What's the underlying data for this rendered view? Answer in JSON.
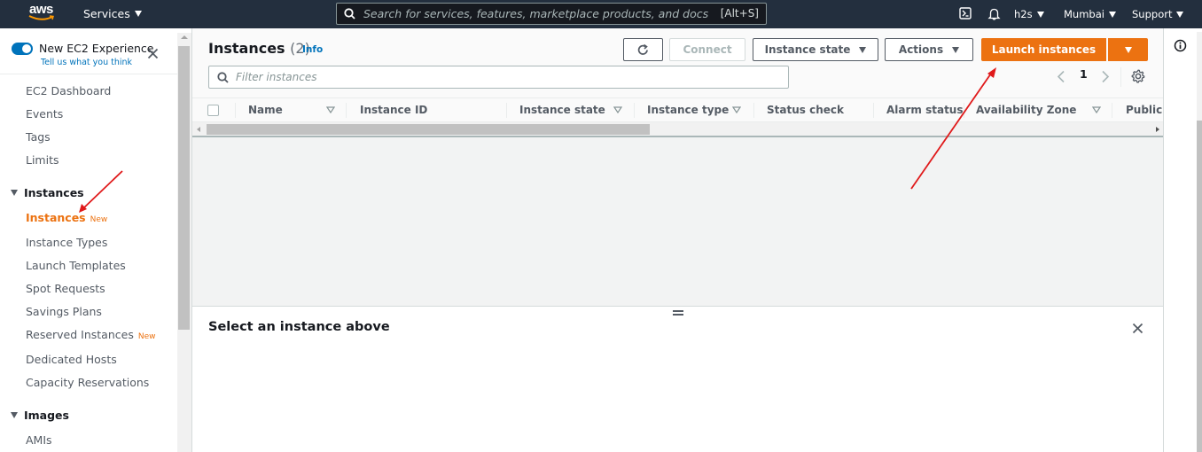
{
  "topnav": {
    "logo": "aws",
    "services_label": "Services",
    "search_placeholder": "Search for services, features, marketplace products, and docs",
    "search_shortcut": "[Alt+S]",
    "account_label": "h2s",
    "region_label": "Mumbai",
    "support_label": "Support",
    "icons": [
      "cloudshell-icon",
      "bell-icon"
    ]
  },
  "sidebar": {
    "new_experience_label": "New EC2 Experience",
    "new_experience_toggle_on": true,
    "feedback_link": "Tell us what you think",
    "top_items": [
      {
        "label": "EC2 Dashboard"
      },
      {
        "label": "Events"
      },
      {
        "label": "Tags"
      },
      {
        "label": "Limits"
      }
    ],
    "sections": [
      {
        "title": "Instances",
        "expanded": true,
        "items": [
          {
            "label": "Instances",
            "badge": "New",
            "active": true
          },
          {
            "label": "Instance Types"
          },
          {
            "label": "Launch Templates"
          },
          {
            "label": "Spot Requests"
          },
          {
            "label": "Savings Plans"
          },
          {
            "label": "Reserved Instances",
            "badge": "New"
          },
          {
            "label": "Dedicated Hosts"
          },
          {
            "label": "Capacity Reservations"
          }
        ]
      },
      {
        "title": "Images",
        "expanded": true,
        "items": [
          {
            "label": "AMIs"
          }
        ]
      }
    ]
  },
  "main": {
    "title": "Instances",
    "count": "(2)",
    "info_link": "Info",
    "buttons": {
      "refresh_icon": "refresh-icon",
      "connect": "Connect",
      "instance_state": "Instance state",
      "actions": "Actions",
      "launch": "Launch instances"
    },
    "filter_placeholder": "Filter instances",
    "pagination": {
      "current_page": "1"
    },
    "table": {
      "columns": [
        {
          "label": "Name",
          "sortable": true
        },
        {
          "label": "Instance ID",
          "sortable": false
        },
        {
          "label": "Instance state",
          "sortable": true
        },
        {
          "label": "Instance type",
          "sortable": true
        },
        {
          "label": "Status check",
          "sortable": false
        },
        {
          "label": "Alarm status",
          "sortable": false
        },
        {
          "label": "Availability Zone",
          "sortable": true
        },
        {
          "label": "Public I",
          "sortable": false
        }
      ],
      "rows": []
    },
    "detail_panel": {
      "title": "Select an instance above"
    }
  },
  "colors": {
    "nav_bg": "#232f3e",
    "accent_orange": "#ec7211",
    "link_blue": "#0073bb",
    "annotation_red": "#e0191a"
  }
}
